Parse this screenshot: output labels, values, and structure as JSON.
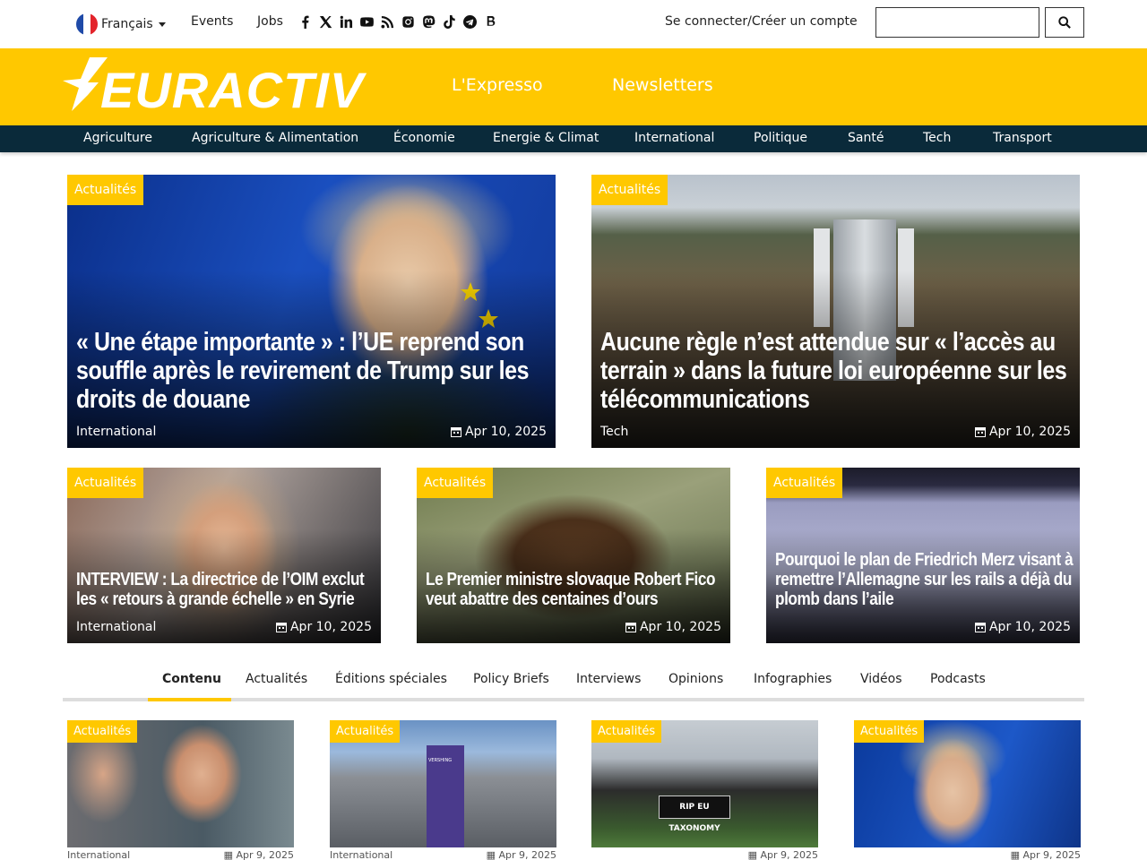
{
  "topbar": {
    "language": "Français",
    "events": "Events",
    "jobs": "Jobs",
    "social_icons": [
      "facebook-icon",
      "x-icon",
      "linkedin-icon",
      "youtube-icon",
      "rss-icon",
      "instagram-icon",
      "mastodon-icon",
      "tiktok-icon",
      "telegram-icon",
      "bluesky-icon"
    ],
    "login": "Se connecter/Créer un compte",
    "search_placeholder": ""
  },
  "brand": {
    "logo_text": "EURACTIV",
    "links": [
      "L'Expresso",
      "Newsletters"
    ]
  },
  "categories": [
    "Agriculture",
    "Agriculture & Alimentation",
    "Économie",
    "Energie & Climat",
    "International",
    "Politique",
    "Santé",
    "Tech",
    "Transport"
  ],
  "featured": [
    {
      "badge": "Actualités",
      "title": "« Une étape importante » : l’UE reprend son souffle après le revirement de Trump sur les droits de douane",
      "category": "International",
      "date": "Apr 10, 2025"
    },
    {
      "badge": "Actualités",
      "title": "Aucune règle n’est attendue sur « l’accès au terrain » dans la future loi européenne sur les télécommunications",
      "category": "Tech",
      "date": "Apr 10, 2025"
    }
  ],
  "secondary": [
    {
      "badge": "Actualités",
      "title": "INTERVIEW : La directrice de l’OIM exclut les « retours à grande échelle » en Syrie",
      "category": "International",
      "date": "Apr 10, 2025"
    },
    {
      "badge": "Actualités",
      "title": "Le Premier ministre slovaque Robert Fico veut abattre des centaines d’ours",
      "category": "",
      "date": "Apr 10, 2025"
    },
    {
      "badge": "Actualités",
      "title": "Pourquoi le plan de Friedrich Merz visant à remettre l’Allemagne sur les rails a déjà du plomb dans l’aile",
      "category": "",
      "date": "Apr 10, 2025"
    }
  ],
  "tabs": [
    "Contenu",
    "Actualités",
    "Éditions spéciales",
    "Policy Briefs",
    "Interviews",
    "Opinions",
    "Infographies",
    "Vidéos",
    "Podcasts"
  ],
  "active_tab": "Contenu",
  "latest": [
    {
      "badge": "Actualités",
      "category": "International",
      "date": "Apr 9, 2025"
    },
    {
      "badge": "Actualités",
      "category": "International",
      "date": "Apr 9, 2025"
    },
    {
      "badge": "Actualités",
      "category": "",
      "date": "Apr 9, 2025"
    },
    {
      "badge": "Actualités",
      "category": "",
      "date": "Apr 9, 2025"
    }
  ],
  "latest_image_texts": {
    "banner_text": "VERSHING",
    "protest_sign": "RIP EU TAXONOMY"
  },
  "colors": {
    "brand_yellow": "#ffc800",
    "nav_dark": "#0a2a3a"
  }
}
